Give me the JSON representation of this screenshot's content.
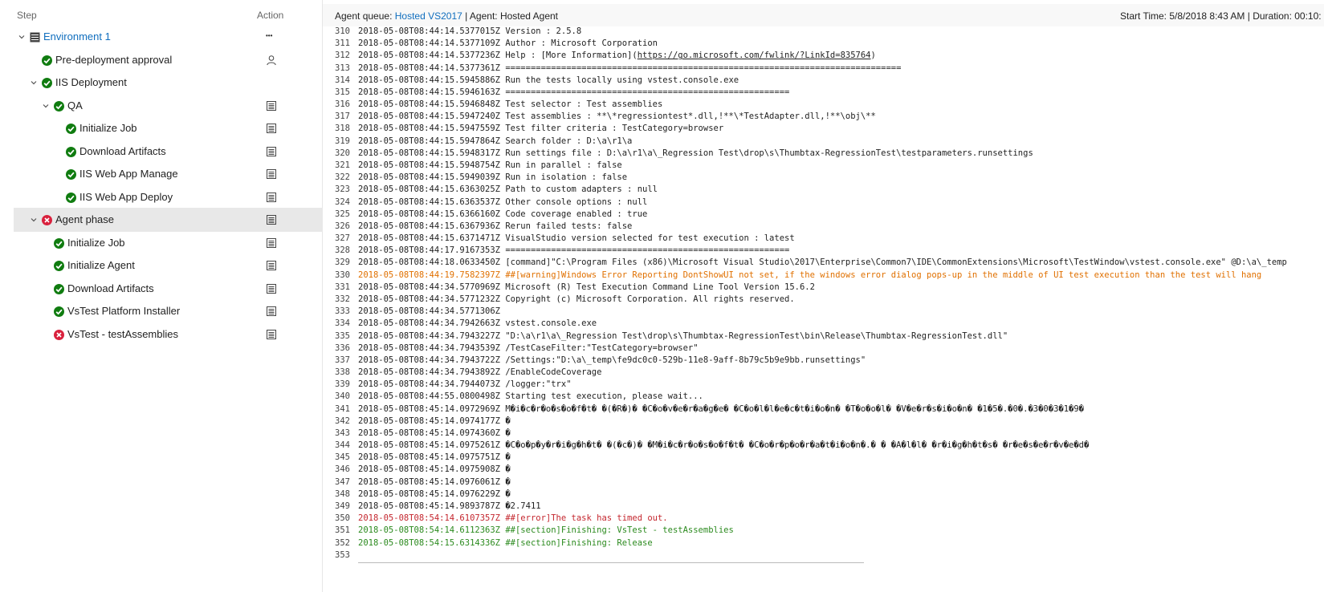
{
  "left": {
    "step_header": "Step",
    "action_header": "Action",
    "rows": [
      {
        "label": "Environment 1",
        "status": "env",
        "action": "more"
      },
      {
        "label": "Pre-deployment approval",
        "status": "ok",
        "action": "person"
      },
      {
        "label": "IIS Deployment",
        "status": "ok",
        "action": ""
      },
      {
        "label": "QA",
        "status": "ok",
        "action": "log"
      },
      {
        "label": "Initialize Job",
        "status": "ok",
        "action": "log"
      },
      {
        "label": "Download Artifacts",
        "status": "ok",
        "action": "log"
      },
      {
        "label": "IIS Web App Manage",
        "status": "ok",
        "action": "log"
      },
      {
        "label": "IIS Web App Deploy",
        "status": "ok",
        "action": "log"
      },
      {
        "label": "Agent phase",
        "status": "err",
        "action": "log"
      },
      {
        "label": "Initialize Job",
        "status": "ok",
        "action": "log"
      },
      {
        "label": "Initialize Agent",
        "status": "ok",
        "action": "log"
      },
      {
        "label": "Download Artifacts",
        "status": "ok",
        "action": "log"
      },
      {
        "label": "VsTest Platform Installer",
        "status": "ok",
        "action": "log"
      },
      {
        "label": "VsTest - testAssemblies",
        "status": "err",
        "action": "log"
      }
    ],
    "more_glyph": "•••"
  },
  "header": {
    "queue_label": "Agent queue: ",
    "queue_value": "Hosted VS2017",
    "agent": " | Agent: Hosted Agent",
    "time": "Start Time: 5/8/2018 8:43 AM | Duration: 00:10:"
  },
  "log": [
    {
      "n": "310",
      "ts": "2018-05-08T08:44:14.5377015Z",
      "msg": "Version      : 2.5.8",
      "kind": "normal"
    },
    {
      "n": "311",
      "ts": "2018-05-08T08:44:14.5377109Z",
      "msg": "Author       : Microsoft Corporation",
      "kind": "normal"
    },
    {
      "n": "312",
      "ts": "2018-05-08T08:44:14.5377236Z",
      "msg": "Help         : [More Information](",
      "link": "https://go.microsoft.com/fwlink/?LinkId=835764",
      "after": ")",
      "kind": "normal"
    },
    {
      "n": "313",
      "ts": "2018-05-08T08:44:14.5377361Z",
      "msg": "==============================================================================",
      "kind": "normal"
    },
    {
      "n": "314",
      "ts": "2018-05-08T08:44:15.5945886Z",
      "msg": "Run the tests locally using vstest.console.exe",
      "kind": "normal"
    },
    {
      "n": "315",
      "ts": "2018-05-08T08:44:15.5946163Z",
      "msg": "========================================================",
      "kind": "normal"
    },
    {
      "n": "316",
      "ts": "2018-05-08T08:44:15.5946848Z",
      "msg": "Test selector : Test assemblies",
      "kind": "normal"
    },
    {
      "n": "317",
      "ts": "2018-05-08T08:44:15.5947240Z",
      "msg": "Test assemblies : **\\*regressiontest*.dll,!**\\*TestAdapter.dll,!**\\obj\\**",
      "kind": "normal"
    },
    {
      "n": "318",
      "ts": "2018-05-08T08:44:15.5947559Z",
      "msg": "Test filter criteria : TestCategory=browser",
      "kind": "normal"
    },
    {
      "n": "319",
      "ts": "2018-05-08T08:44:15.5947864Z",
      "msg": "Search folder : D:\\a\\r1\\a",
      "kind": "normal"
    },
    {
      "n": "320",
      "ts": "2018-05-08T08:44:15.5948317Z",
      "msg": "Run settings file : D:\\a\\r1\\a\\_Regression Test\\drop\\s\\Thumbtax-RegressionTest\\testparameters.runsettings",
      "kind": "normal"
    },
    {
      "n": "321",
      "ts": "2018-05-08T08:44:15.5948754Z",
      "msg": "Run in parallel : false",
      "kind": "normal"
    },
    {
      "n": "322",
      "ts": "2018-05-08T08:44:15.5949039Z",
      "msg": "Run in isolation : false",
      "kind": "normal"
    },
    {
      "n": "323",
      "ts": "2018-05-08T08:44:15.6363025Z",
      "msg": "Path to custom adapters : null",
      "kind": "normal"
    },
    {
      "n": "324",
      "ts": "2018-05-08T08:44:15.6363537Z",
      "msg": "Other console options : null",
      "kind": "normal"
    },
    {
      "n": "325",
      "ts": "2018-05-08T08:44:15.6366160Z",
      "msg": "Code coverage enabled : true",
      "kind": "normal"
    },
    {
      "n": "326",
      "ts": "2018-05-08T08:44:15.6367936Z",
      "msg": "Rerun failed tests: false",
      "kind": "normal"
    },
    {
      "n": "327",
      "ts": "2018-05-08T08:44:15.6371471Z",
      "msg": "VisualStudio version selected for test execution : latest",
      "kind": "normal"
    },
    {
      "n": "328",
      "ts": "2018-05-08T08:44:17.9167353Z",
      "msg": "========================================================",
      "kind": "normal"
    },
    {
      "n": "329",
      "ts": "2018-05-08T08:44:18.0633450Z",
      "msg": "[command]\"C:\\Program Files (x86)\\Microsoft Visual Studio\\2017\\Enterprise\\Common7\\IDE\\CommonExtensions\\Microsoft\\TestWindow\\vstest.console.exe\" @D:\\a\\_temp",
      "kind": "normal"
    },
    {
      "n": "330",
      "ts": "2018-05-08T08:44:19.7582397Z",
      "msg": "##[warning]Windows Error Reporting DontShowUI not set, if the windows error dialog pops-up in the middle of UI test execution than the test will hang",
      "kind": "warn"
    },
    {
      "n": "331",
      "ts": "2018-05-08T08:44:34.5770969Z",
      "msg": "Microsoft (R) Test Execution Command Line Tool Version 15.6.2",
      "kind": "normal"
    },
    {
      "n": "332",
      "ts": "2018-05-08T08:44:34.5771232Z",
      "msg": "Copyright (c) Microsoft Corporation.  All rights reserved.",
      "kind": "normal"
    },
    {
      "n": "333",
      "ts": "2018-05-08T08:44:34.5771306Z",
      "msg": "",
      "kind": "normal"
    },
    {
      "n": "334",
      "ts": "2018-05-08T08:44:34.7942663Z",
      "msg": "vstest.console.exe",
      "kind": "normal"
    },
    {
      "n": "335",
      "ts": "2018-05-08T08:44:34.7943227Z",
      "msg": "\"D:\\a\\r1\\a\\_Regression Test\\drop\\s\\Thumbtax-RegressionTest\\bin\\Release\\Thumbtax-RegressionTest.dll\"",
      "kind": "normal"
    },
    {
      "n": "336",
      "ts": "2018-05-08T08:44:34.7943539Z",
      "msg": "/TestCaseFilter:\"TestCategory=browser\"",
      "kind": "normal"
    },
    {
      "n": "337",
      "ts": "2018-05-08T08:44:34.7943722Z",
      "msg": "/Settings:\"D:\\a\\_temp\\fe9dc0c0-529b-11e8-9aff-8b79c5b9e9bb.runsettings\"",
      "kind": "normal"
    },
    {
      "n": "338",
      "ts": "2018-05-08T08:44:34.7943892Z",
      "msg": "/EnableCodeCoverage",
      "kind": "normal"
    },
    {
      "n": "339",
      "ts": "2018-05-08T08:44:34.7944073Z",
      "msg": "/logger:\"trx\"",
      "kind": "normal"
    },
    {
      "n": "340",
      "ts": "2018-05-08T08:44:55.0800498Z",
      "msg": "Starting test execution, please wait...",
      "kind": "normal"
    },
    {
      "n": "341",
      "ts": "2018-05-08T08:45:14.0972969Z",
      "msg": "M�i�c�r�o�s�o�f�t� �(�R�)� �C�o�v�e�r�a�g�e� �C�o�l�l�e�c�t�i�o�n� �T�o�o�l� �V�e�r�s�i�o�n� �1�5�.�0�.�3�0�3�1�9�",
      "kind": "normal"
    },
    {
      "n": "342",
      "ts": "2018-05-08T08:45:14.0974177Z",
      "msg": "�",
      "kind": "normal"
    },
    {
      "n": "343",
      "ts": "2018-05-08T08:45:14.0974360Z",
      "msg": "�",
      "kind": "normal"
    },
    {
      "n": "344",
      "ts": "2018-05-08T08:45:14.0975261Z",
      "msg": "�C�o�p�y�r�i�g�h�t� �(�c�)� �M�i�c�r�o�s�o�f�t� �C�o�r�p�o�r�a�t�i�o�n�.� � �A�l�l� �r�i�g�h�t�s� �r�e�s�e�r�v�e�d�",
      "kind": "normal"
    },
    {
      "n": "345",
      "ts": "2018-05-08T08:45:14.0975751Z",
      "msg": "�",
      "kind": "normal"
    },
    {
      "n": "346",
      "ts": "2018-05-08T08:45:14.0975908Z",
      "msg": "�",
      "kind": "normal"
    },
    {
      "n": "347",
      "ts": "2018-05-08T08:45:14.0976061Z",
      "msg": "�",
      "kind": "normal"
    },
    {
      "n": "348",
      "ts": "2018-05-08T08:45:14.0976229Z",
      "msg": "�",
      "kind": "normal"
    },
    {
      "n": "349",
      "ts": "2018-05-08T08:45:14.9893787Z",
      "msg": "�2.7411",
      "kind": "normal"
    },
    {
      "n": "350",
      "ts": "2018-05-08T08:54:14.6107357Z",
      "msg": "##[error]The task has timed out.",
      "kind": "error"
    },
    {
      "n": "351",
      "ts": "2018-05-08T08:54:14.6112363Z",
      "msg": "##[section]Finishing: VsTest - testAssemblies",
      "kind": "section"
    },
    {
      "n": "352",
      "ts": "2018-05-08T08:54:15.6314336Z",
      "msg": "##[section]Finishing: Release",
      "kind": "section"
    },
    {
      "n": "353",
      "ts": "",
      "msg": "",
      "kind": "normal"
    }
  ]
}
